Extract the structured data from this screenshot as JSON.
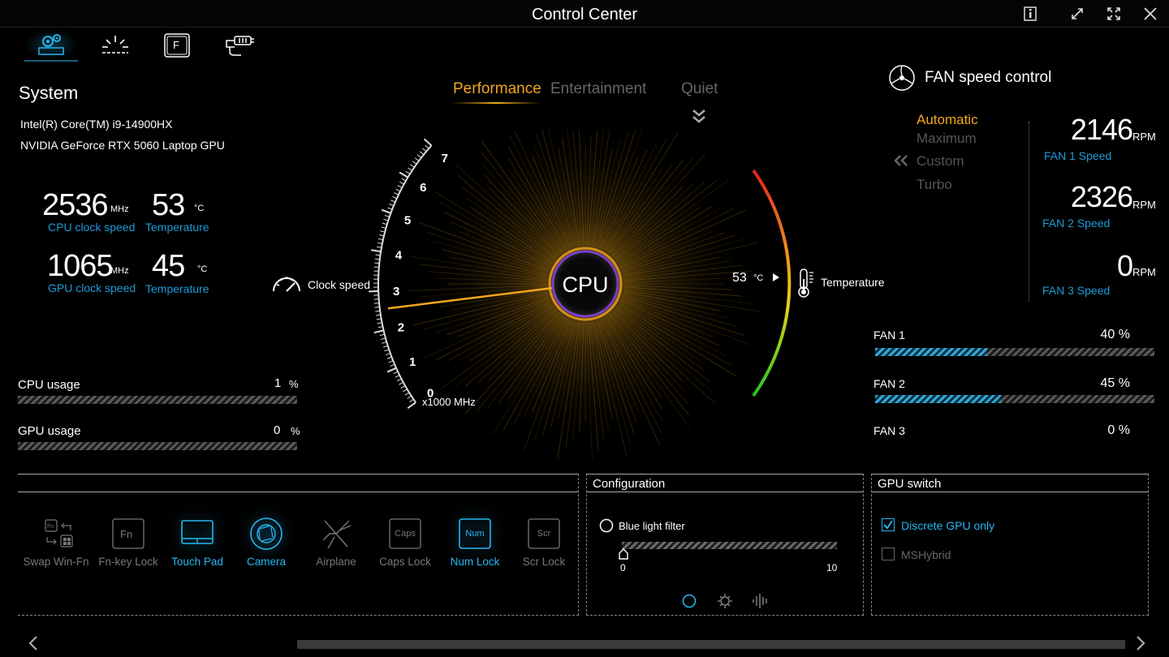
{
  "window": {
    "title": "Control Center"
  },
  "nav": {
    "items": [
      {
        "name": "system-settings",
        "active": true
      },
      {
        "name": "lighting",
        "active": false
      },
      {
        "name": "function-keys",
        "active": false
      },
      {
        "name": "connectivity",
        "active": false
      }
    ]
  },
  "system": {
    "title": "System",
    "cpu_name": "Intel(R) Core(TM) i9-14900HX",
    "gpu_name": "NVIDIA GeForce RTX 5060 Laptop GPU",
    "cpu_clock": "2536",
    "cpu_clock_unit": "MHz",
    "cpu_clock_caption": "CPU clock speed",
    "cpu_temp": "53",
    "cpu_temp_unit": "°C",
    "cpu_temp_caption": "Temperature",
    "gpu_clock": "1065",
    "gpu_clock_unit": "MHz",
    "gpu_clock_caption": "GPU clock speed",
    "gpu_temp": "45",
    "gpu_temp_unit": "°C",
    "gpu_temp_caption": "Temperature",
    "cpu_usage_label": "CPU usage",
    "cpu_usage_value": "1",
    "cpu_usage_unit": "%",
    "gpu_usage_label": "GPU usage",
    "gpu_usage_value": "0",
    "gpu_usage_unit": "%"
  },
  "modes": {
    "performance": "Performance",
    "entertainment": "Entertainment",
    "quiet": "Quiet",
    "active": "Performance"
  },
  "gauge": {
    "center_label": "CPU",
    "clock_label": "Clock speed",
    "temp_label": "Temperature",
    "scale_unit": "x1000 MHz",
    "ticks": [
      "0",
      "1",
      "2",
      "3",
      "4",
      "5",
      "6",
      "7"
    ],
    "clock_value_ghz": 2.536,
    "temp_value": "53",
    "temp_unit": "°C"
  },
  "fan_control": {
    "title": "FAN speed control",
    "modes": [
      "Automatic",
      "Maximum",
      "Custom",
      "Turbo"
    ],
    "active_mode": "Automatic",
    "fans": [
      {
        "rpm": "2146",
        "unit": "RPM",
        "caption": "FAN 1 Speed",
        "label": "FAN 1",
        "percent": "40",
        "fill": 0.4
      },
      {
        "rpm": "2326",
        "unit": "RPM",
        "caption": "FAN 2 Speed",
        "label": "FAN 2",
        "percent": "45",
        "fill": 0.45
      },
      {
        "rpm": "0",
        "unit": "RPM",
        "caption": "FAN 3 Speed",
        "label": "FAN 3",
        "percent": "0",
        "fill": 0.0
      }
    ],
    "percent_unit": "%"
  },
  "hotkeys": {
    "items": [
      {
        "label": "Swap Win-Fn",
        "on": false,
        "icon": "swap-win-fn-icon"
      },
      {
        "label": "Fn-key Lock",
        "on": false,
        "icon": "fn-key-icon"
      },
      {
        "label": "Touch Pad",
        "on": true,
        "icon": "touchpad-icon"
      },
      {
        "label": "Camera",
        "on": true,
        "icon": "camera-icon"
      },
      {
        "label": "Airplane",
        "on": false,
        "icon": "airplane-icon"
      },
      {
        "label": "Caps Lock",
        "on": false,
        "icon": "caps-lock-icon",
        "key": "Caps"
      },
      {
        "label": "Num Lock",
        "on": true,
        "icon": "num-lock-icon",
        "key": "Num"
      },
      {
        "label": "Scr Lock",
        "on": false,
        "icon": "scroll-lock-icon",
        "key": "Scr"
      }
    ],
    "fn_key": "Fn",
    "fkey": "F"
  },
  "configuration": {
    "title": "Configuration",
    "blue_light_label": "Blue light filter",
    "slider_min": "0",
    "slider_max": "10",
    "slider_value": 0
  },
  "gpu_switch": {
    "title": "GPU switch",
    "options": [
      {
        "label": "Discrete GPU only",
        "checked": true
      },
      {
        "label": "MSHybrid",
        "checked": false
      }
    ]
  },
  "colors": {
    "accent_orange": "#f2a81d",
    "accent_blue": "#1e9bd7",
    "background": "#000000"
  }
}
